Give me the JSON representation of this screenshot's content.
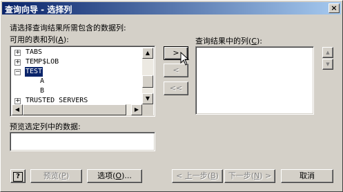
{
  "window": {
    "title": "查询向导 - 选择列",
    "close_icon": "×"
  },
  "instructions": "请选择查询结果所需包含的数据列:",
  "available": {
    "label_prefix": "可用的表和列(",
    "label_key": "A",
    "label_suffix": "):",
    "items": [
      {
        "expander": "+",
        "text": "TABS",
        "indent": 0
      },
      {
        "expander": "+",
        "text": "TEMP$LOB",
        "indent": 0
      },
      {
        "expander": "−",
        "text": "TEST",
        "indent": 0,
        "selected": true
      },
      {
        "expander": "",
        "text": "A",
        "indent": 1
      },
      {
        "expander": "",
        "text": "B",
        "indent": 1
      },
      {
        "expander": "+",
        "text": "TRUSTED SERVERS",
        "indent": 0
      }
    ]
  },
  "buttons": {
    "add": ">",
    "remove": "<",
    "remove_all": "<<",
    "move_up": "▲",
    "move_down": "▼"
  },
  "result": {
    "label_prefix": "查询结果中的列(",
    "label_key": "C",
    "label_suffix": "):"
  },
  "preview": {
    "label": "预览选定列中的数据:"
  },
  "footer": {
    "help": "?",
    "preview_prefix": "预览(",
    "preview_key": "P",
    "preview_suffix": ")",
    "options_prefix": "选项(",
    "options_key": "O",
    "options_suffix": ")...",
    "back_prefix": "< 上一步(",
    "back_key": "B",
    "back_suffix": ")",
    "next_prefix": "下一步(",
    "next_key": "N",
    "next_suffix": ") >",
    "cancel": "取消"
  }
}
